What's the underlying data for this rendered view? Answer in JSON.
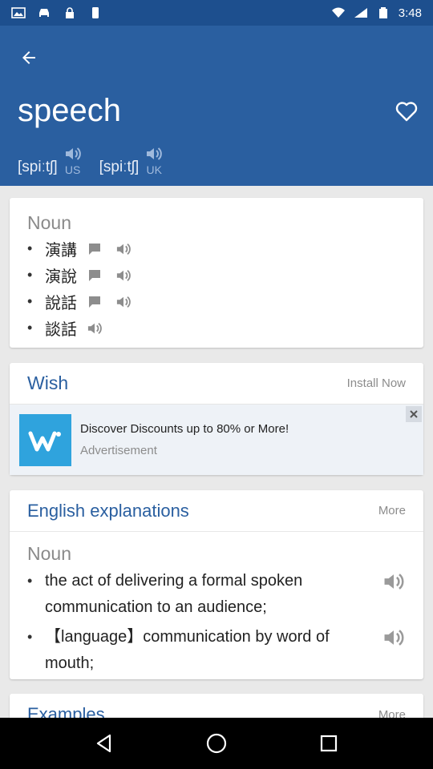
{
  "status_bar": {
    "time": "3:48",
    "left_icons": [
      "image-icon",
      "car-icon",
      "lock-icon",
      "phone-icon"
    ],
    "right_icons": [
      "wifi-icon",
      "signal-icon",
      "battery-icon"
    ]
  },
  "header": {
    "word": "speech",
    "pronunciations": [
      {
        "ipa": "[spiːtʃ]",
        "region": "US"
      },
      {
        "ipa": "[spiːtʃ]",
        "region": "UK"
      }
    ],
    "bg_color": "#2a5fa0"
  },
  "meanings": {
    "pos": "Noun",
    "items": [
      {
        "text": "演講",
        "has_note": true
      },
      {
        "text": "演說",
        "has_note": true
      },
      {
        "text": "說話",
        "has_note": true
      },
      {
        "text": "談話",
        "has_note": false
      }
    ]
  },
  "ad": {
    "brand": "Wish",
    "install_label": "Install Now",
    "title": "Discover Discounts up to 80% or More!",
    "subtitle": "Advertisement",
    "logo_color": "#2fa3dd"
  },
  "explanations": {
    "title": "English explanations",
    "more_label": "More",
    "pos": "Noun",
    "definitions": [
      "the act of delivering a formal spoken communication to an audience;",
      "【language】communication by word of mouth;"
    ]
  },
  "examples": {
    "title": "Examples",
    "more_label": "More"
  },
  "colors": {
    "accent": "#2a5fa0",
    "status_bar": "#1d4f8e"
  }
}
